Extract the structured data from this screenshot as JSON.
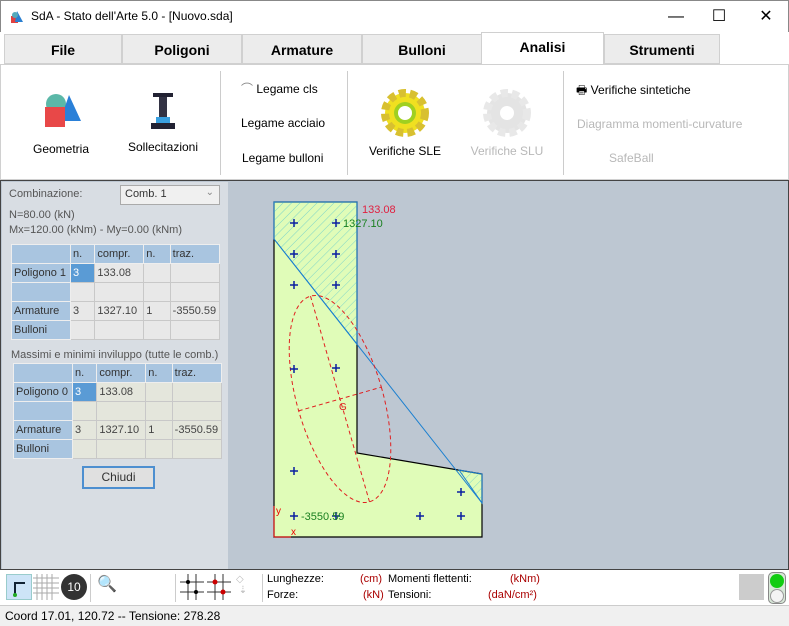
{
  "window": {
    "title": "SdA - Stato dell'Arte 5.0 - [Nuovo.sda]",
    "minimize": "—",
    "maximize": "☐",
    "close": "✕"
  },
  "tabs": [
    {
      "label": "File"
    },
    {
      "label": "Poligoni"
    },
    {
      "label": "Armature"
    },
    {
      "label": "Bulloni"
    },
    {
      "label": "Analisi",
      "active": true
    },
    {
      "label": "Strumenti"
    }
  ],
  "ribbon": {
    "geometria": "Geometria",
    "sollecitazioni": "Sollecitazioni",
    "legame_cls": "Legame cls",
    "legame_acciaio": "Legame acciaio",
    "legame_bulloni": "Legame bulloni",
    "verifiche_sle": "Verifiche SLE",
    "verifiche_slu": "Verifiche SLU",
    "verifiche_sintetiche": "Verifiche sintetiche",
    "diagramma": "Diagramma momenti-curvature",
    "safeball": "SafeBall"
  },
  "panel": {
    "combinazione_label": "Combinazione:",
    "combinazione_value": "Comb. 1",
    "n_line": "N=80.00 (kN)",
    "m_line": "Mx=120.00 (kNm) - My=0.00 (kNm)",
    "headers": [
      "",
      "n.",
      "compr.",
      "n.",
      "traz."
    ],
    "table1": [
      [
        "Poligono 1",
        "3",
        "133.08",
        "",
        ""
      ],
      [
        "",
        "",
        "",
        "",
        ""
      ],
      [
        "Armature",
        "3",
        "1327.10",
        "1",
        "-3550.59"
      ],
      [
        "Bulloni",
        "",
        "",
        "",
        ""
      ]
    ],
    "envelope_label": "Massimi e minimi inviluppo (tutte le comb.)",
    "table2": [
      [
        "Poligono 0",
        "3",
        "133.08",
        "",
        ""
      ],
      [
        "",
        "",
        "",
        "",
        ""
      ],
      [
        "Armature",
        "3",
        "1327.10",
        "1",
        "-3550.59"
      ],
      [
        "Bulloni",
        "",
        "",
        "",
        ""
      ]
    ],
    "close_button": "Chiudi"
  },
  "drawing": {
    "max_compr": "133.08",
    "max_bar_compr": "1327.10",
    "max_bar_traz": "-3550.59",
    "centroid": "G",
    "axis_x": "x",
    "axis_y": "y",
    "fill_color": "#e0fcb8",
    "neutral_line_color": "#1a7fd0",
    "ellipse_color": "#e02020"
  },
  "units": {
    "lunghezze": "Lunghezze:",
    "lunghezze_u": "(cm)",
    "forze": "Forze:",
    "forze_u": "(kN)",
    "momenti": "Momenti flettenti:",
    "momenti_u": "(kNm)",
    "tensioni": "Tensioni:",
    "tensioni_u": "(daN/cm²)"
  },
  "toolbar": {
    "font_size_badge": "10"
  },
  "status": {
    "text": "Coord 17.01, 120.72 -- Tensione: 278.28"
  }
}
